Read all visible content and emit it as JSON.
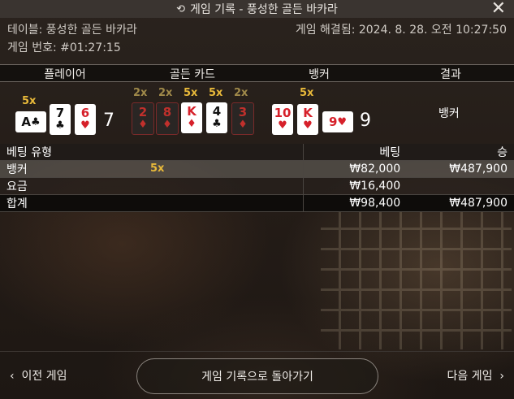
{
  "title": "게임 기록 - 풍성한 골든 바카라",
  "title_icon": "history-icon",
  "close_label": "✕",
  "table_info": "테이블: 풍성한 골든 바카라",
  "game_number": "게임 번호: #01:27:15",
  "resolved": "게임 해결됨: 2024. 8. 28. 오전 10:27:50",
  "columns": {
    "player": "플레이어",
    "golden": "골든 카드",
    "banker": "뱅커",
    "result": "결과"
  },
  "player": {
    "multiplier": "5x",
    "cards": [
      {
        "rank": "A",
        "suit": "♣",
        "color": "black",
        "sideways": true
      },
      {
        "rank": "7",
        "suit": "♣",
        "color": "black"
      },
      {
        "rank": "6",
        "suit": "♥",
        "color": "red"
      }
    ],
    "score": "7"
  },
  "golden": {
    "cards": [
      {
        "rank": "2",
        "suit": "♦",
        "color": "red",
        "mult": "2x",
        "active": false
      },
      {
        "rank": "8",
        "suit": "♦",
        "color": "red",
        "mult": "2x",
        "active": false
      },
      {
        "rank": "K",
        "suit": "♦",
        "color": "red",
        "mult": "5x",
        "active": true
      },
      {
        "rank": "4",
        "suit": "♣",
        "color": "black",
        "mult": "5x",
        "active": true
      },
      {
        "rank": "3",
        "suit": "♦",
        "color": "red",
        "mult": "2x",
        "active": false
      }
    ]
  },
  "banker": {
    "multiplier": "5x",
    "cards": [
      {
        "rank": "10",
        "suit": "♥",
        "color": "red"
      },
      {
        "rank": "K",
        "suit": "♥",
        "color": "red"
      },
      {
        "rank": "9",
        "suit": "♥",
        "color": "red",
        "sideways": true
      }
    ],
    "score": "9"
  },
  "result": "뱅커",
  "bets": {
    "headers": {
      "type": "베팅 유형",
      "bet": "베팅",
      "win": "승"
    },
    "rows": [
      {
        "type": "뱅커",
        "badge": "5x",
        "bet": "₩82,000",
        "win": "₩487,900"
      },
      {
        "type": "요금",
        "bet": "₩16,400",
        "win": ""
      },
      {
        "type": "합계",
        "bet": "₩98,400",
        "win": "₩487,900"
      }
    ]
  },
  "footer": {
    "prev": "이전 게임",
    "back": "게임 기록으로 돌아가기",
    "next": "다음 게임"
  },
  "colors": {
    "gold": "#e8b93a",
    "red": "#d6202a"
  }
}
